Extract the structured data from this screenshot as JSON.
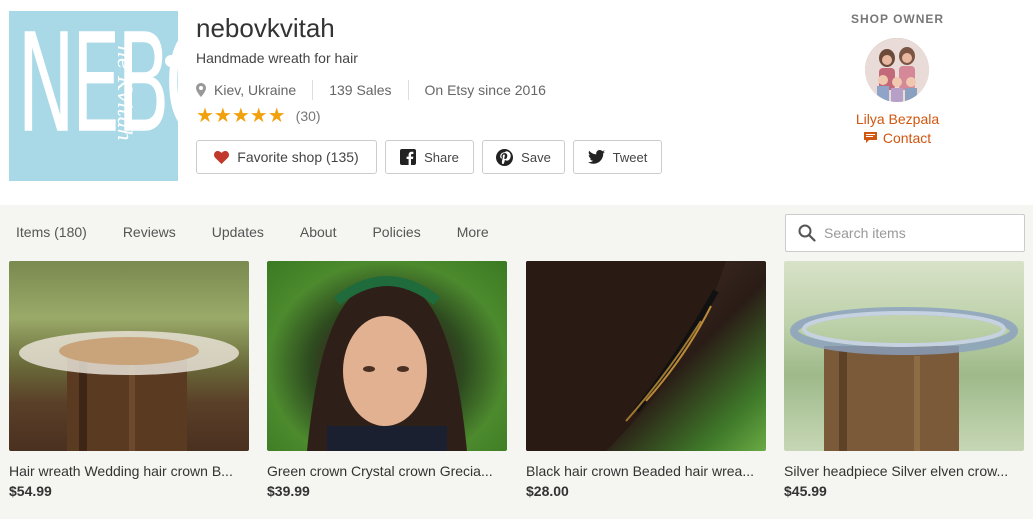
{
  "shop": {
    "logo_text": "NEBO",
    "logo_script": "ne Kvitah",
    "name": "nebovkvitah",
    "tagline": "Handmade wreath for hair",
    "location": "Kiev, Ukraine",
    "sales": "139 Sales",
    "since": "On Etsy since 2016",
    "stars": "★★★★★",
    "rating_count": "(30)",
    "icons": {
      "location": "map-pin-icon",
      "favorite": "heart-icon",
      "share": "facebook-icon",
      "save": "pinterest-icon",
      "tweet": "twitter-icon"
    },
    "colors": {
      "star": "#f1a10d",
      "heart": "#c0392b",
      "accent": "#d1560f",
      "logo_bg": "#a9d9e7"
    }
  },
  "actions": {
    "favorite_label": "Favorite shop (135)",
    "share_label": "Share",
    "save_label": "Save",
    "tweet_label": "Tweet"
  },
  "owner": {
    "heading": "SHOP OWNER",
    "name": "Lilya Bezpala",
    "contact_label": "Contact",
    "icons": {
      "contact": "mail-icon"
    }
  },
  "nav": {
    "tabs": [
      "Items (180)",
      "Reviews",
      "Updates",
      "About",
      "Policies",
      "More"
    ],
    "search_placeholder": "Search items",
    "search_icon": "search-icon"
  },
  "listings": [
    {
      "title": "Hair wreath Wedding hair crown B...",
      "price": "$54.99"
    },
    {
      "title": "Green crown Crystal crown Grecia...",
      "price": "$39.99"
    },
    {
      "title": "Black hair crown Beaded hair wrea...",
      "price": "$28.00"
    },
    {
      "title": "Silver headpiece Silver elven crow...",
      "price": "$45.99"
    }
  ]
}
